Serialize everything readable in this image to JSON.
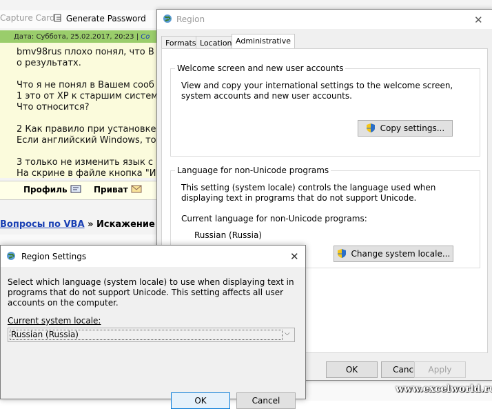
{
  "background": {
    "toolbar": {
      "capture_card": "Capture Card",
      "generate_password": "Generate Password"
    },
    "post": {
      "date": "Дата: Суббота, 25.02.2017, 20:23 |",
      "date_tail": "Со",
      "lines": [
        "bmv98rus плохо понял, что В",
        "о результатх.",
        "",
        "Что я не понял в Вашем сооб",
        "1 это от XP к старшим систем",
        "Что относится?",
        "",
        "2 Как правило при установке",
        "Если английский Windows, то",
        "",
        "3 только не изменить язык с",
        "На скрине в файле кнопка \"И"
      ]
    },
    "profile_bar": {
      "profile": "Профиль",
      "private": "Приват"
    },
    "breadcrumb": {
      "link": "Вопросы по VBA",
      "sep": "»",
      "current": "Искажение"
    },
    "watermark": "www.excelworld.ru"
  },
  "region_dialog": {
    "title": "Region",
    "tabs": [
      "Formats",
      "Location",
      "Administrative"
    ],
    "welcome_group": {
      "legend": "Welcome screen and new user accounts",
      "text": "View and copy your international settings to the welcome screen, system accounts and new user accounts.",
      "button": "Copy settings..."
    },
    "unicode_group": {
      "legend": "Language for non-Unicode programs",
      "text": "This setting (system locale) controls the language used when displaying text in programs that do not support Unicode.",
      "current_label": "Current language for non-Unicode programs:",
      "current_value": "Russian (Russia)",
      "button": "Change system locale..."
    },
    "buttons": {
      "ok": "OK",
      "cancel": "Cancel",
      "apply": "Apply"
    }
  },
  "region_settings_dialog": {
    "title": "Region Settings",
    "description": "Select which language (system locale) to use when displaying text in programs that do not support Unicode. This setting affects all user accounts on the computer.",
    "label": "Current system locale:",
    "selected": "Russian (Russia)",
    "buttons": {
      "ok": "OK",
      "cancel": "Cancel"
    }
  },
  "colors": {
    "accent": "#0078d7",
    "post_header": "#9acd6b",
    "post_body": "#fbfbdc"
  }
}
